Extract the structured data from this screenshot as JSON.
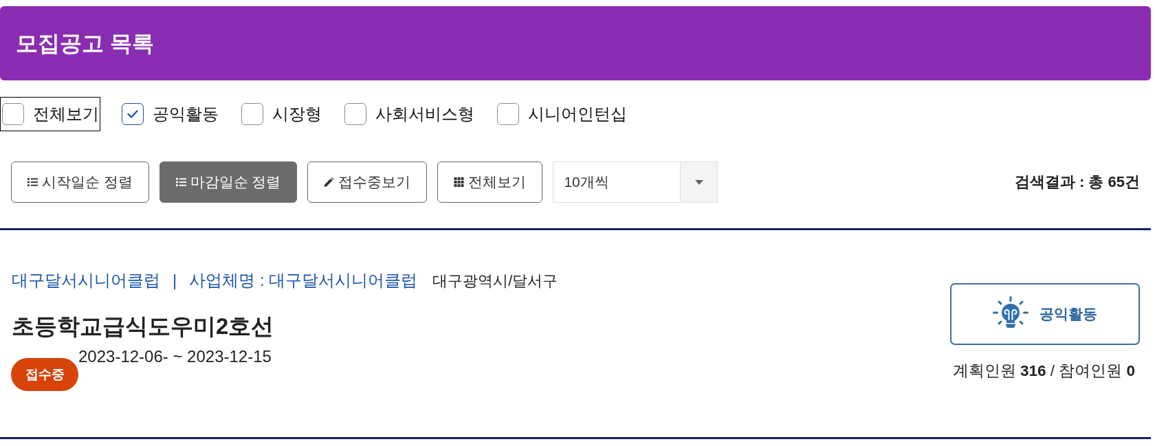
{
  "header": {
    "title": "모집공고 목록"
  },
  "filters": [
    {
      "label": "전체보기",
      "checked": false,
      "focused": true
    },
    {
      "label": "공익활동",
      "checked": true,
      "focused": false
    },
    {
      "label": "시장형",
      "checked": false,
      "focused": false
    },
    {
      "label": "사회서비스형",
      "checked": false,
      "focused": false
    },
    {
      "label": "시니어인턴십",
      "checked": false,
      "focused": false
    }
  ],
  "toolbar": {
    "buttons": [
      {
        "kind": "sort",
        "label": "시작일순 정렬",
        "selected": false
      },
      {
        "kind": "sort",
        "label": "마감일순 정렬",
        "selected": true
      },
      {
        "kind": "filter",
        "label": "접수중보기",
        "selected": false
      },
      {
        "kind": "all",
        "label": "전체보기",
        "selected": false
      }
    ],
    "page_size": {
      "value": "10개씩"
    },
    "result_count": "검색결과 : 총 **65**건"
  },
  "listings": [
    {
      "organization": "대구달서시니어클럽",
      "separator": "|",
      "business": "사업체명 : 대구달서시니어클럽",
      "region": "대구광역시/달서구",
      "title": "초등학교급식도우미2호선",
      "status": "접수중",
      "period": "2023-12-06- ~ 2023-12-15",
      "category": "공익활동",
      "headcount": "계획인원 **316** / 참여인원 **0**"
    }
  ]
}
